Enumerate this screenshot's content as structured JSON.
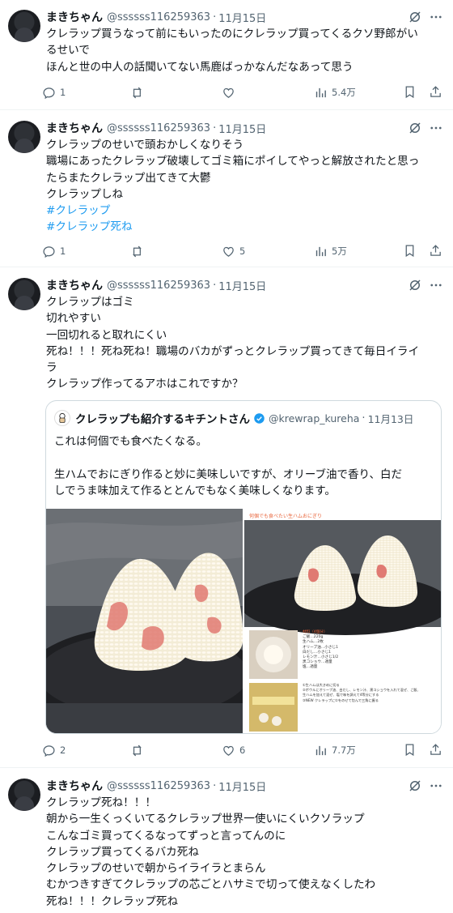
{
  "tweets": [
    {
      "name": "まきちゃん",
      "handle": "@ssssss116259363",
      "date": "11月15日",
      "lines": [
        "クレラップ買うなって前にもいったのにクレラップ買ってくるクソ野郎がい",
        "るせいで",
        "ほんと世の中人の話聞いてない馬鹿ばっかなんだなあって思う"
      ],
      "replies": "1",
      "retweets": "",
      "likes": "",
      "views": "5.4万"
    },
    {
      "name": "まきちゃん",
      "handle": "@ssssss116259363",
      "date": "11月15日",
      "lines": [
        "クレラップのせいで頭おかしくなりそう",
        "職場にあったクレラップ破壊してゴミ箱にポイしてやっと解放されたと思っ",
        "たらまたクレラップ出てきて大鬱",
        "クレラップしね"
      ],
      "hashtags": [
        "#クレラップ",
        "#クレラップ死ね"
      ],
      "replies": "1",
      "retweets": "",
      "likes": "5",
      "views": "5万"
    },
    {
      "name": "まきちゃん",
      "handle": "@ssssss116259363",
      "date": "11月15日",
      "lines": [
        "クレラップはゴミ",
        "切れやすい",
        "一回切れると取れにくい",
        "死ね！！！死ね死ね！職場のバカがずっとクレラップ買ってきて毎日イライ",
        "ラ",
        "クレラップ作ってるアホはこれですか？"
      ],
      "quote": {
        "name": "クレラップも紹介するキチントさん",
        "handle": "@krewrap_kureha",
        "date": "11月13日",
        "lines": [
          "これは何個でも食べたくなる。",
          "",
          "生ハムでおにぎり作ると妙に美味しいですが、オリーブ油で香り、白だ",
          "しでうま味加えて作るととんでもなく美味しくなります。"
        ],
        "image_title": "何個でも食べたい生ハムおにぎり",
        "recipe_header": "材料（4個分）",
        "recipe_lines": [
          "ご飯…220g",
          "生ハム…2枚",
          "オリーブ油…小さじ1",
          "白だし…小さじ1",
          "レモン汁…小さじ1/2",
          "黒コショウ…適量",
          "塩…適量"
        ],
        "step_lines": [
          "①生ハムは大きめに切る",
          "②ボウルにオリーブ油、白だし、レモン汁、黒コショウを入れて混ぜ、ご飯、",
          "生ハムを加えて混ぜ、塩で味を調えて4等分にする",
          "③NEW クレラップに①をのせて包んで三角に握る"
        ]
      },
      "replies": "2",
      "retweets": "",
      "likes": "6",
      "views": "7.7万"
    },
    {
      "name": "まきちゃん",
      "handle": "@ssssss116259363",
      "date": "11月15日",
      "lines": [
        "クレラップ死ね！！！",
        "朝から一生くっくいてるクレラップ世界一使いにくいクソラップ",
        "こんなゴミ買ってくるなってずっと言ってんのに",
        "クレラップ買ってくるバカ死ね",
        "クレラップのせいで朝からイライラとまらん",
        "むかつきすぎてクレラップの芯ごとハサミで切って使えなくしたわ",
        "死ね！！！クレラップ死ね"
      ]
    }
  ],
  "separator": "·",
  "colors": {
    "text": "#0f1419",
    "muted": "#536471",
    "link": "#1d9bf0",
    "border": "#eff3f4"
  }
}
